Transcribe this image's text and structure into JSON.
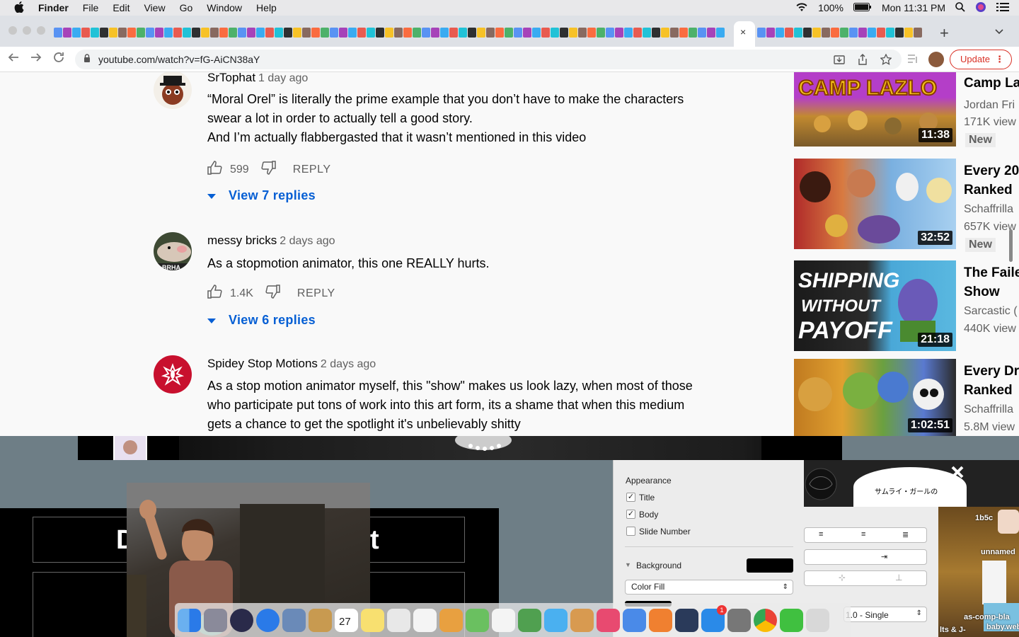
{
  "menubar": {
    "app": "Finder",
    "items": [
      "File",
      "Edit",
      "View",
      "Go",
      "Window",
      "Help"
    ],
    "battery": "100%",
    "clock": "Mon 11:31 PM"
  },
  "browser": {
    "url": "youtube.com/watch?v=fG-AiCN38aY",
    "update_label": "Update",
    "close_tab_glyph": "×",
    "new_tab_glyph": "+"
  },
  "comments": [
    {
      "author": "SrTophat",
      "time": "1 day ago",
      "text_lines": [
        "“Moral Orel” is literally the prime example that you don’t have to make the characters",
        "swear a lot in order to actually tell a good story.",
        "And I’m actually flabbergasted that it wasn’t mentioned in this video"
      ],
      "likes": "599",
      "reply_label": "REPLY",
      "view_replies": "View 7 replies",
      "avatar_color": "#8a3b22"
    },
    {
      "author": "messy bricks",
      "time": "2 days ago",
      "text_lines": [
        "As a stopmotion animator, this one REALLY hurts."
      ],
      "likes": "1.4K",
      "reply_label": "REPLY",
      "view_replies": "View 6 replies",
      "avatar_color": "#4c5a3e"
    },
    {
      "author": "Spidey Stop Motions",
      "time": "2 days ago",
      "text_lines": [
        "As a stop motion animator myself, this \"show\" makes us look lazy, when most of those",
        "who participate put tons of work into this art form, its a shame that when this medium",
        "gets a chance to get the spotlight it's unbelievably shitty"
      ],
      "avatar_color": "#c8102e"
    }
  ],
  "sidebar": [
    {
      "title": "Camp La",
      "title2": "",
      "channel": "Jordan Fri",
      "views": "171K view",
      "badge": "New",
      "duration": "11:38",
      "thumb_colors": [
        "#b43ec8",
        "#f0c020"
      ]
    },
    {
      "title": "Every 20",
      "title2": "Ranked",
      "channel": "Schaffrilla",
      "views": "657K view",
      "badge": "New",
      "duration": "32:52",
      "thumb_colors": [
        "#c03030",
        "#5aa0e0"
      ]
    },
    {
      "title": "The Faile",
      "title2": "Show",
      "channel": "Sarcastic (",
      "views": "440K view",
      "badge": "",
      "duration": "21:18",
      "thumb_colors": [
        "#2a2a2a",
        "#3aa5d0"
      ]
    },
    {
      "title": "Every Dre",
      "title2": "Ranked",
      "channel": "Schaffrilla",
      "views": "5.8M view",
      "badge": "",
      "duration": "1:02:51",
      "thumb_colors": [
        "#d08020",
        "#4a8a30"
      ]
    }
  ],
  "keynote": {
    "section": "Appearance",
    "checks": [
      {
        "label": "Title",
        "checked": "✓"
      },
      {
        "label": "Body",
        "checked": "✓"
      },
      {
        "label": "Slide Number",
        "checked": ""
      }
    ],
    "background_label": "Background",
    "fill_select": "Color Fill",
    "spacing_select": "1.0 - Single"
  },
  "desktop": {
    "labels": [
      "1b5c",
      "unnamed",
      "as-comp-bla",
      "baby.webp",
      "lts & J-"
    ]
  },
  "dock": {
    "icons": [
      "finder-icon",
      "launchpad-icon",
      "siri-icon",
      "safari-icon",
      "preview-icon",
      "notes-brown-icon",
      "calendar-icon",
      "stickies-icon",
      "pen-icon",
      "reminders-icon",
      "photos-icon",
      "maps-icon",
      "textedit-icon",
      "numbers-icon",
      "messages-icon",
      "garageband-icon",
      "music-icon",
      "keynote-icon",
      "books-icon",
      "quicktime-icon",
      "appstore-icon",
      "settings-icon",
      "chrome-icon",
      "facetime-icon",
      "trash-icon"
    ],
    "calendar_date": "27",
    "appstore_badge": "1"
  }
}
